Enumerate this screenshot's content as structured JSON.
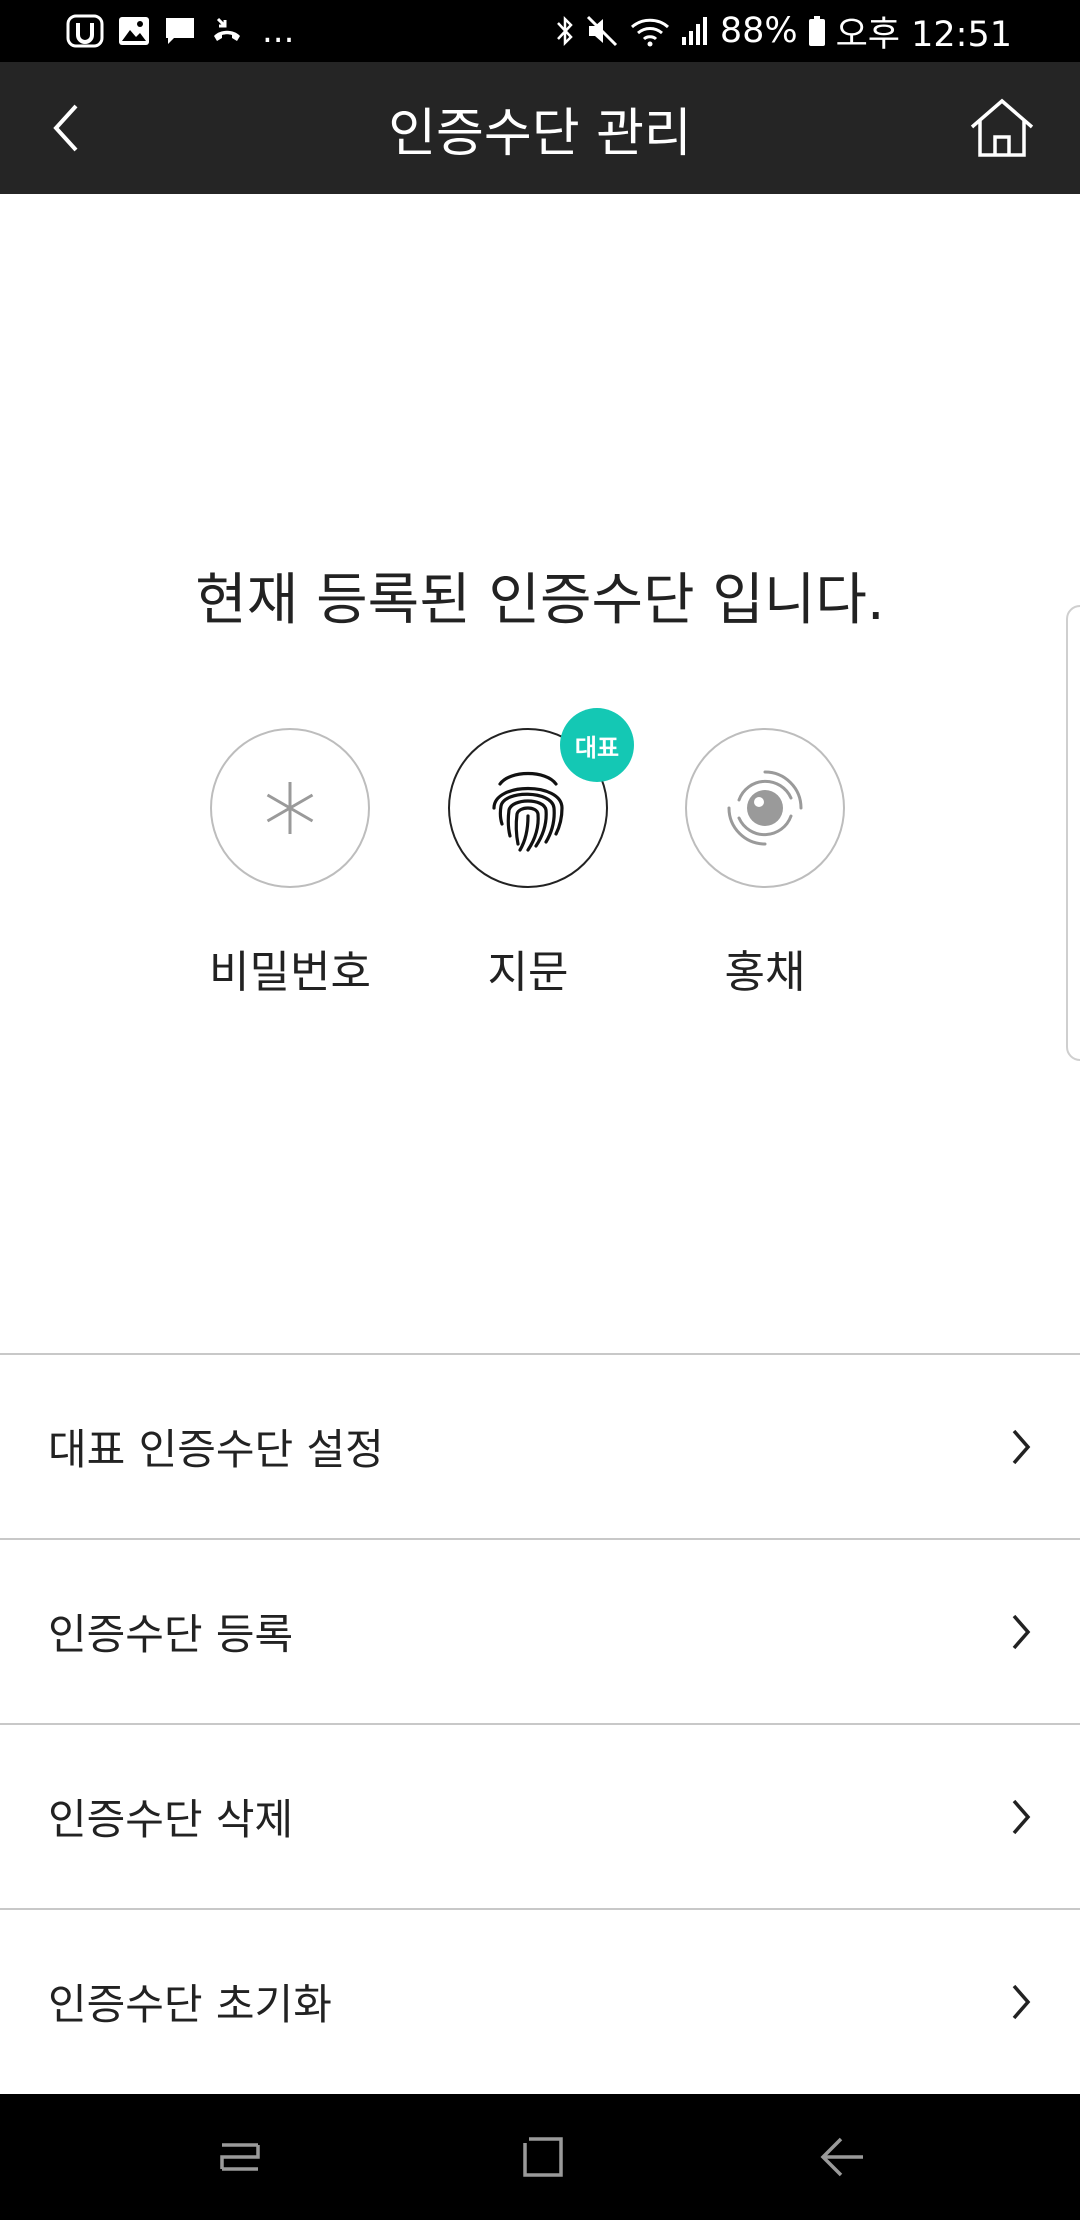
{
  "status_bar": {
    "battery_percent": "88%",
    "time": "오후 12:51",
    "more_indicator": "..."
  },
  "app_bar": {
    "title": "인증수단 관리"
  },
  "main": {
    "headline": "현재 등록된 인증수단 입니다.",
    "methods": [
      {
        "label": "비밀번호",
        "icon": "asterisk-icon",
        "active": false
      },
      {
        "label": "지문",
        "icon": "fingerprint-icon",
        "active": true,
        "badge": "대표"
      },
      {
        "label": "홍채",
        "icon": "iris-icon",
        "active": false
      }
    ],
    "badge_color": "#14c8b4"
  },
  "menu": {
    "items": [
      {
        "label": "대표 인증수단 설정"
      },
      {
        "label": "인증수단 등록"
      },
      {
        "label": "인증수단 삭제"
      },
      {
        "label": "인증수단 초기화"
      }
    ]
  }
}
